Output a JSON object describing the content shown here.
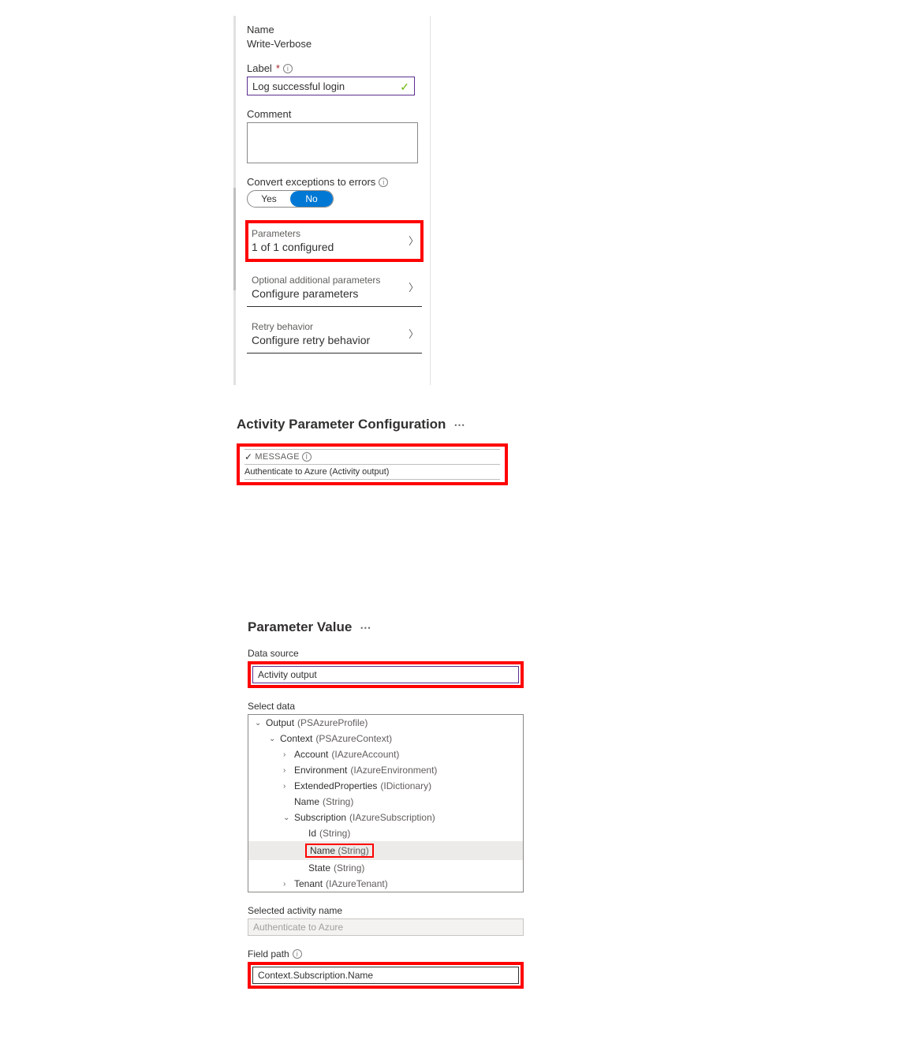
{
  "panel1": {
    "name_label": "Name",
    "name_value": "Write-Verbose",
    "label_label": "Label",
    "label_value": "Log successful login",
    "comment_label": "Comment",
    "convert_label": "Convert exceptions to errors",
    "toggle_yes": "Yes",
    "toggle_no": "No",
    "rows": [
      {
        "title": "Parameters",
        "value": "1 of 1 configured"
      },
      {
        "title": "Optional additional parameters",
        "value": "Configure parameters"
      },
      {
        "title": "Retry behavior",
        "value": "Configure retry behavior"
      }
    ]
  },
  "panel2": {
    "title": "Activity Parameter Configuration",
    "msg_head": "MESSAGE",
    "msg_value": "Authenticate to Azure (Activity output)"
  },
  "panel3": {
    "title": "Parameter Value",
    "data_source_label": "Data source",
    "data_source_value": "Activity output",
    "select_data_label": "Select data",
    "tree": {
      "output": "Output",
      "output_t": "(PSAzureProfile)",
      "context": "Context",
      "context_t": "(PSAzureContext)",
      "account": "Account",
      "account_t": "(IAzureAccount)",
      "env": "Environment",
      "env_t": "(IAzureEnvironment)",
      "ext": "ExtendedProperties",
      "ext_t": "(IDictionary)",
      "cname": "Name",
      "cname_t": "(String)",
      "sub": "Subscription",
      "sub_t": "(IAzureSubscription)",
      "id": "Id",
      "id_t": "(String)",
      "sname": "Name",
      "sname_t": "(String)",
      "state": "State",
      "state_t": "(String)",
      "tenant": "Tenant",
      "tenant_t": "(IAzureTenant)"
    },
    "sel_act_label": "Selected activity name",
    "sel_act_value": "Authenticate to Azure",
    "field_path_label": "Field path",
    "field_path_value": "Context.Subscription.Name"
  }
}
